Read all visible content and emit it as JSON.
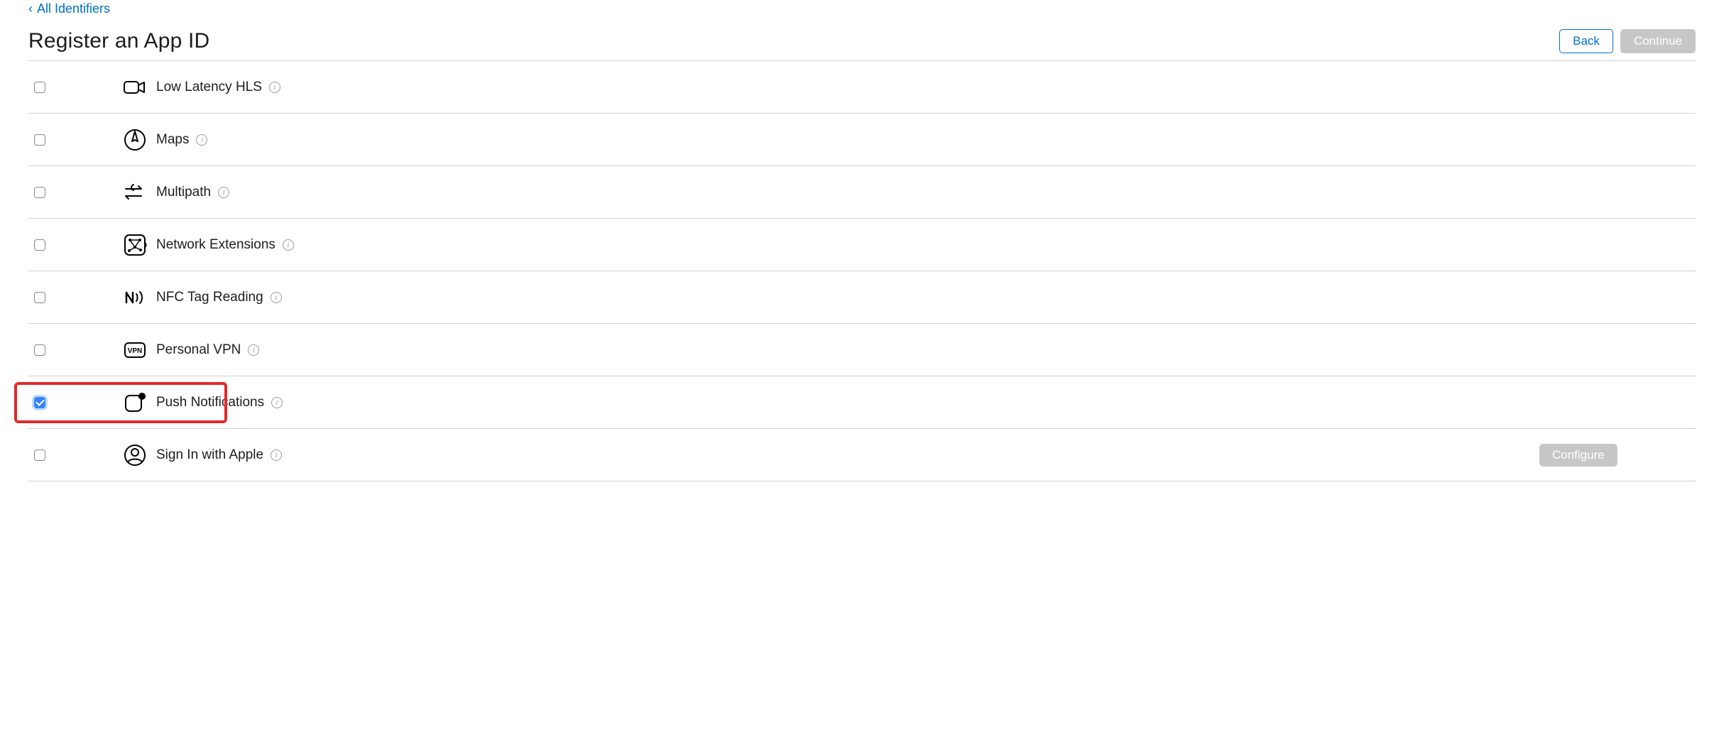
{
  "nav": {
    "back_link_label": "All Identifiers"
  },
  "header": {
    "title": "Register an App ID",
    "back_button_label": "Back",
    "continue_button_label": "Continue"
  },
  "capabilities": [
    {
      "id": "low-latency-hls",
      "label": "Low Latency HLS",
      "checked": false,
      "icon": "video-camera",
      "has_info": true,
      "action": null
    },
    {
      "id": "maps",
      "label": "Maps",
      "checked": false,
      "icon": "compass",
      "has_info": true,
      "action": null
    },
    {
      "id": "multipath",
      "label": "Multipath",
      "checked": false,
      "icon": "multipath-arrows",
      "has_info": true,
      "action": null
    },
    {
      "id": "network-extensions",
      "label": "Network Extensions",
      "checked": false,
      "icon": "network-graph",
      "has_info": true,
      "action": null
    },
    {
      "id": "nfc-tag-reading",
      "label": "NFC Tag Reading",
      "checked": false,
      "icon": "nfc-waves",
      "has_info": true,
      "action": null
    },
    {
      "id": "personal-vpn",
      "label": "Personal VPN",
      "checked": false,
      "icon": "vpn-badge",
      "has_info": true,
      "action": null
    },
    {
      "id": "push-notifications",
      "label": "Push Notifications",
      "checked": true,
      "icon": "push-badge",
      "has_info": true,
      "action": null
    },
    {
      "id": "sign-in-with-apple",
      "label": "Sign In with Apple",
      "checked": false,
      "icon": "person-circle",
      "has_info": true,
      "action": "Configure"
    }
  ],
  "annotations": {
    "highlight_row_id": "push-notifications"
  },
  "actions": {
    "configure_label": "Configure"
  }
}
